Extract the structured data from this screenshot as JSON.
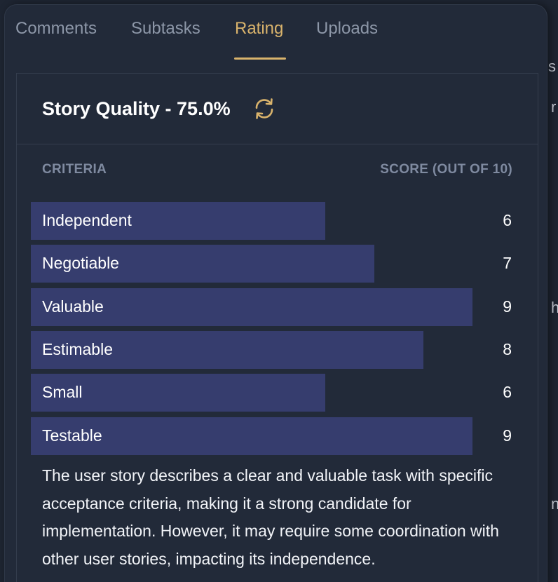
{
  "tabs": [
    {
      "label": "Comments",
      "active": false
    },
    {
      "label": "Subtasks",
      "active": false
    },
    {
      "label": "Rating",
      "active": true
    },
    {
      "label": "Uploads",
      "active": false
    }
  ],
  "rating": {
    "title": "Story Quality - 75.0%",
    "refresh_icon": "refresh-icon",
    "columns": {
      "criteria": "CRITERIA",
      "score": "SCORE (OUT OF 10)"
    },
    "max_score": 10,
    "criteria": [
      {
        "name": "Independent",
        "score": "6"
      },
      {
        "name": "Negotiable",
        "score": "7"
      },
      {
        "name": "Valuable",
        "score": "9"
      },
      {
        "name": "Estimable",
        "score": "8"
      },
      {
        "name": "Small",
        "score": "6"
      },
      {
        "name": "Testable",
        "score": "9"
      }
    ],
    "summary": "The user story describes a clear and valuable task with specific acceptance criteria, making it a strong candidate for implementation. However, it may require some coordination with other user stories, impacting its independence."
  },
  "colors": {
    "accent": "#d9b36c",
    "bar": "#363d6e",
    "panel": "#222a39",
    "background": "#1e2532"
  }
}
